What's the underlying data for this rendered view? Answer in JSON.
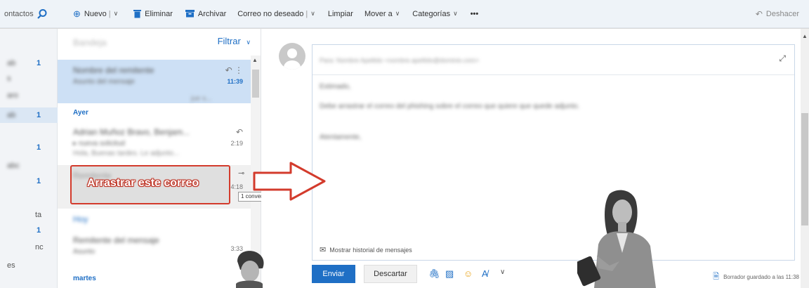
{
  "toolbar": {
    "search_label": "ontactos",
    "new_label": "Nuevo",
    "delete_label": "Eliminar",
    "archive_label": "Archivar",
    "junk_label": "Correo no deseado",
    "sweep_label": "Limpiar",
    "move_label": "Mover a",
    "categories_label": "Categorías",
    "more_label": "•••",
    "undo_label": "Deshacer"
  },
  "folders": {
    "counts": [
      "1",
      "1",
      "1",
      "1",
      "1"
    ],
    "partial_names": [
      "ta",
      "nc",
      "es"
    ]
  },
  "list": {
    "filter_label": "Filtrar",
    "day_yesterday": "Ayer",
    "day_tuesday": "martes",
    "times": [
      "11:39",
      "2:19",
      "4:18",
      "3:33"
    ]
  },
  "annotation": {
    "drag_label": "Arrastrar este correo",
    "tooltip": "1 conversación"
  },
  "reading": {
    "history_label": "Mostrar historial de mensajes",
    "send_label": "Enviar",
    "discard_label": "Descartar",
    "saved_label": "Borrador guardado a las 11:38"
  },
  "colors": {
    "accent": "#1f6fc5",
    "selection": "#cde0f5",
    "callout_border": "#d33b2c"
  }
}
